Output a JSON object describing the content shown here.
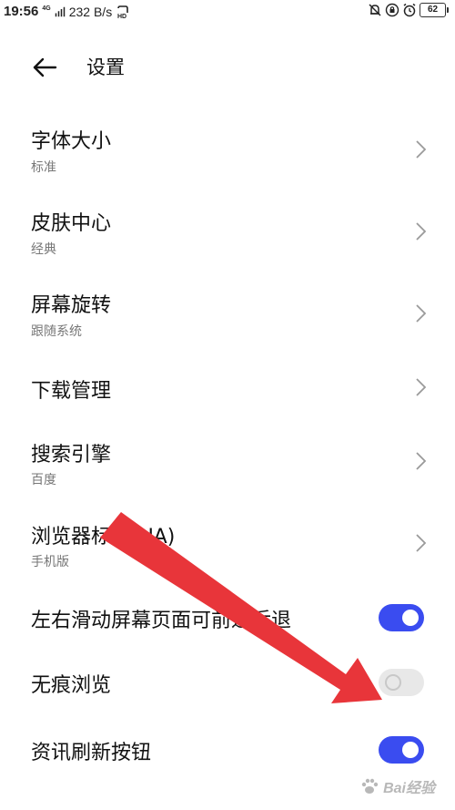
{
  "status_bar": {
    "time": "19:56",
    "network_type": "4G",
    "speed": "232 B/s",
    "battery": "62"
  },
  "header": {
    "title": "设置"
  },
  "settings": [
    {
      "label": "字体大小",
      "sub": "标准"
    },
    {
      "label": "皮肤中心",
      "sub": "经典"
    },
    {
      "label": "屏幕旋转",
      "sub": "跟随系统"
    },
    {
      "label": "下载管理",
      "sub": ""
    },
    {
      "label": "搜索引擎",
      "sub": "百度"
    },
    {
      "label": "浏览器标识(UA)",
      "sub": "手机版"
    }
  ],
  "toggles": [
    {
      "label": "左右滑动屏幕页面可前进后退",
      "state": "on"
    },
    {
      "label": "无痕浏览",
      "state": "off"
    },
    {
      "label": "资讯刷新按钮",
      "state": "on"
    }
  ],
  "colors": {
    "toggle_on": "#3a4cf0",
    "toggle_off": "#e8e8e8",
    "annotation_arrow": "#e8353a"
  },
  "watermark": {
    "text": "Bai经验"
  }
}
